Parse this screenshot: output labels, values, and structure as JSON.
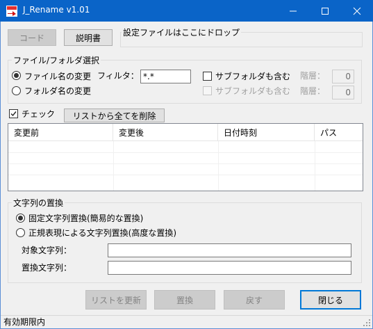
{
  "window": {
    "title": "J_Rename v1.01"
  },
  "toolbar": {
    "code_button": "コード",
    "manual_button": "説明書",
    "drop_zone_label": "設定ファイルはここにドロップ"
  },
  "selection_group": {
    "legend": "ファイル/フォルダ選択",
    "file_rename_label": "ファイル名の変更",
    "folder_rename_label": "フォルダ名の変更",
    "filter_label": "フィルタ：",
    "filter_value": "*.*",
    "subfolder_label_1": "サブフォルダも含む",
    "subfolder_label_2": "サブフォルダも含む",
    "depth_label_1": "階層：",
    "depth_label_2": "階層：",
    "depth_value_1": "0",
    "depth_value_2": "0"
  },
  "check_row": {
    "check_label": "チェック",
    "clear_list_button": "リストから全てを削除"
  },
  "list": {
    "columns": [
      "変更前",
      "変更後",
      "日付時刻",
      "パス"
    ]
  },
  "replace_group": {
    "legend": "文字列の置換",
    "fixed_label": "固定文字列置換(簡易的な置換)",
    "regex_label": "正規表現による文字列置換(高度な置換)",
    "target_label": "対象文字列：",
    "replacement_label": "置換文字列：",
    "target_value": "",
    "replacement_value": ""
  },
  "footer": {
    "refresh_button": "リストを更新",
    "replace_button": "置換",
    "undo_button": "戻す",
    "close_button": "閉じる"
  },
  "status": {
    "text": "有効期限内"
  },
  "colors": {
    "titlebar": "#0a64c8",
    "focus_border": "#0078d7"
  }
}
